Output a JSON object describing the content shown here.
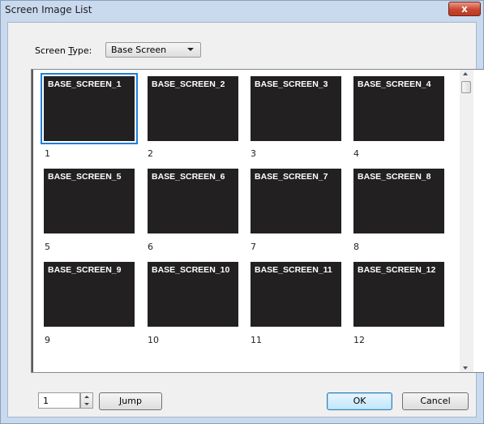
{
  "window": {
    "title": "Screen Image List",
    "close_glyph": "x"
  },
  "screen_type": {
    "label_pre": "Screen ",
    "label_hotkey": "T",
    "label_post": "ype:",
    "selected": "Base Screen"
  },
  "screens": [
    {
      "name": "BASE_SCREEN_1",
      "number": "1"
    },
    {
      "name": "BASE_SCREEN_2",
      "number": "2"
    },
    {
      "name": "BASE_SCREEN_3",
      "number": "3"
    },
    {
      "name": "BASE_SCREEN_4",
      "number": "4"
    },
    {
      "name": "BASE_SCREEN_5",
      "number": "5"
    },
    {
      "name": "BASE_SCREEN_6",
      "number": "6"
    },
    {
      "name": "BASE_SCREEN_7",
      "number": "7"
    },
    {
      "name": "BASE_SCREEN_8",
      "number": "8"
    },
    {
      "name": "BASE_SCREEN_9",
      "number": "9"
    },
    {
      "name": "BASE_SCREEN_10",
      "number": "10"
    },
    {
      "name": "BASE_SCREEN_11",
      "number": "11"
    },
    {
      "name": "BASE_SCREEN_12",
      "number": "12"
    }
  ],
  "jump": {
    "value": "1",
    "button_hotkey": "J",
    "button_rest": "ump"
  },
  "buttons": {
    "ok": "OK",
    "cancel": "Cancel"
  },
  "colors": {
    "selection": "#1f7fd9",
    "thumbnail_bg": "#222021",
    "close_button": "#c9452f"
  }
}
